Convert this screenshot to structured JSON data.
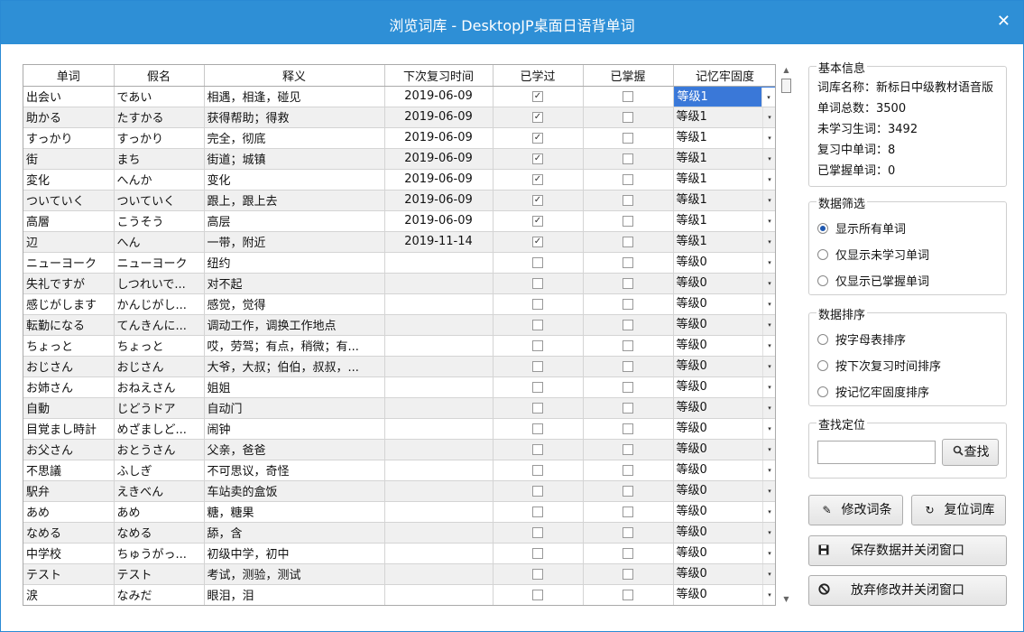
{
  "window": {
    "title": "浏览词库 - DesktopJP桌面日语背单词",
    "close_glyph": "✕"
  },
  "grid": {
    "columns": [
      "单词",
      "假名",
      "释义",
      "下次复习时间",
      "已学过",
      "已掌握",
      "记忆牢固度"
    ],
    "rows": [
      {
        "word": "出会い",
        "kana": "であい",
        "meaning": "相遇，相逢，碰见",
        "date": "2019-06-09",
        "learned": true,
        "mastered": false,
        "level": "等级1"
      },
      {
        "word": "助かる",
        "kana": "たすかる",
        "meaning": "获得帮助；得救",
        "date": "2019-06-09",
        "learned": true,
        "mastered": false,
        "level": "等级1"
      },
      {
        "word": "すっかり",
        "kana": "すっかり",
        "meaning": "完全，彻底",
        "date": "2019-06-09",
        "learned": true,
        "mastered": false,
        "level": "等级1"
      },
      {
        "word": "街",
        "kana": "まち",
        "meaning": "街道；城镇",
        "date": "2019-06-09",
        "learned": true,
        "mastered": false,
        "level": "等级1"
      },
      {
        "word": "変化",
        "kana": "へんか",
        "meaning": "变化",
        "date": "2019-06-09",
        "learned": true,
        "mastered": false,
        "level": "等级1"
      },
      {
        "word": "ついていく",
        "kana": "ついていく",
        "meaning": "跟上，跟上去",
        "date": "2019-06-09",
        "learned": true,
        "mastered": false,
        "level": "等级1"
      },
      {
        "word": "高層",
        "kana": "こうそう",
        "meaning": "高层",
        "date": "2019-06-09",
        "learned": true,
        "mastered": false,
        "level": "等级1"
      },
      {
        "word": "辺",
        "kana": "へん",
        "meaning": "一带，附近",
        "date": "2019-11-14",
        "learned": true,
        "mastered": false,
        "level": "等级1"
      },
      {
        "word": "ニューヨーク",
        "kana": "ニューヨーク",
        "meaning": "纽约",
        "date": "",
        "learned": false,
        "mastered": false,
        "level": "等级0"
      },
      {
        "word": "失礼ですが",
        "kana": "しつれいで...",
        "meaning": "对不起",
        "date": "",
        "learned": false,
        "mastered": false,
        "level": "等级0"
      },
      {
        "word": "感じがします",
        "kana": "かんじがし...",
        "meaning": "感觉，觉得",
        "date": "",
        "learned": false,
        "mastered": false,
        "level": "等级0"
      },
      {
        "word": "転勤になる",
        "kana": "てんきんに...",
        "meaning": "调动工作，调换工作地点",
        "date": "",
        "learned": false,
        "mastered": false,
        "level": "等级0"
      },
      {
        "word": "ちょっと",
        "kana": "ちょっと",
        "meaning": "哎，劳驾；有点，稍微；有...",
        "date": "",
        "learned": false,
        "mastered": false,
        "level": "等级0"
      },
      {
        "word": "おじさん",
        "kana": "おじさん",
        "meaning": "大爷，大叔；伯伯，叔叔，...",
        "date": "",
        "learned": false,
        "mastered": false,
        "level": "等级0"
      },
      {
        "word": "お姉さん",
        "kana": "おねえさん",
        "meaning": "姐姐",
        "date": "",
        "learned": false,
        "mastered": false,
        "level": "等级0"
      },
      {
        "word": "自動",
        "kana": "じどうドア",
        "meaning": "自动门",
        "date": "",
        "learned": false,
        "mastered": false,
        "level": "等级0"
      },
      {
        "word": "目覚まし時計",
        "kana": "めざましど...",
        "meaning": "闹钟",
        "date": "",
        "learned": false,
        "mastered": false,
        "level": "等级0"
      },
      {
        "word": "お父さん",
        "kana": "おとうさん",
        "meaning": "父亲，爸爸",
        "date": "",
        "learned": false,
        "mastered": false,
        "level": "等级0"
      },
      {
        "word": "不思議",
        "kana": "ふしぎ",
        "meaning": "不可思议，奇怪",
        "date": "",
        "learned": false,
        "mastered": false,
        "level": "等级0"
      },
      {
        "word": "駅弁",
        "kana": "えきべん",
        "meaning": "车站卖的盒饭",
        "date": "",
        "learned": false,
        "mastered": false,
        "level": "等级0"
      },
      {
        "word": "あめ",
        "kana": "あめ",
        "meaning": "糖，糖果",
        "date": "",
        "learned": false,
        "mastered": false,
        "level": "等级0"
      },
      {
        "word": "なめる",
        "kana": "なめる",
        "meaning": "舔，含",
        "date": "",
        "learned": false,
        "mastered": false,
        "level": "等级0"
      },
      {
        "word": "中学校",
        "kana": "ちゅうがっ...",
        "meaning": "初级中学，初中",
        "date": "",
        "learned": false,
        "mastered": false,
        "level": "等级0"
      },
      {
        "word": "テスト",
        "kana": "テスト",
        "meaning": "考试，测验，测试",
        "date": "",
        "learned": false,
        "mastered": false,
        "level": "等级0"
      },
      {
        "word": "涙",
        "kana": "なみだ",
        "meaning": "眼泪，泪",
        "date": "",
        "learned": false,
        "mastered": false,
        "level": "等级0"
      }
    ],
    "selected_row": 0,
    "check_glyph": "✓",
    "dropdown_glyph": "▾"
  },
  "basic_info": {
    "legend": "基本信息",
    "lines": [
      "词库名称：新标日中级教材语音版",
      "单词总数：3500",
      "未学习生词：3492",
      "复习中单词：8",
      "已掌握单词：0"
    ]
  },
  "filter": {
    "legend": "数据筛选",
    "options": [
      "显示所有单词",
      "仅显示未学习单词",
      "仅显示已掌握单词"
    ],
    "selected": 0
  },
  "sort": {
    "legend": "数据排序",
    "options": [
      "按字母表排序",
      "按下次复习时间排序",
      "按记忆牢固度排序"
    ],
    "selected": -1
  },
  "search": {
    "legend": "查找定位",
    "value": "",
    "placeholder": "",
    "button_label": "查找",
    "icon": "search-icon"
  },
  "buttons": {
    "edit": {
      "label": "修改词条",
      "icon": "pen-icon"
    },
    "reset": {
      "label": "复位词库",
      "icon": "reset-icon"
    },
    "save": {
      "label": "保存数据并关闭窗口",
      "icon": "save-icon"
    },
    "discard": {
      "label": "放弃修改并关闭窗口",
      "icon": "cancel-icon"
    }
  },
  "colors": {
    "titlebar": "#2e8fd6",
    "selection": "#3a78d8",
    "alt_row": "#f0f0f0"
  }
}
